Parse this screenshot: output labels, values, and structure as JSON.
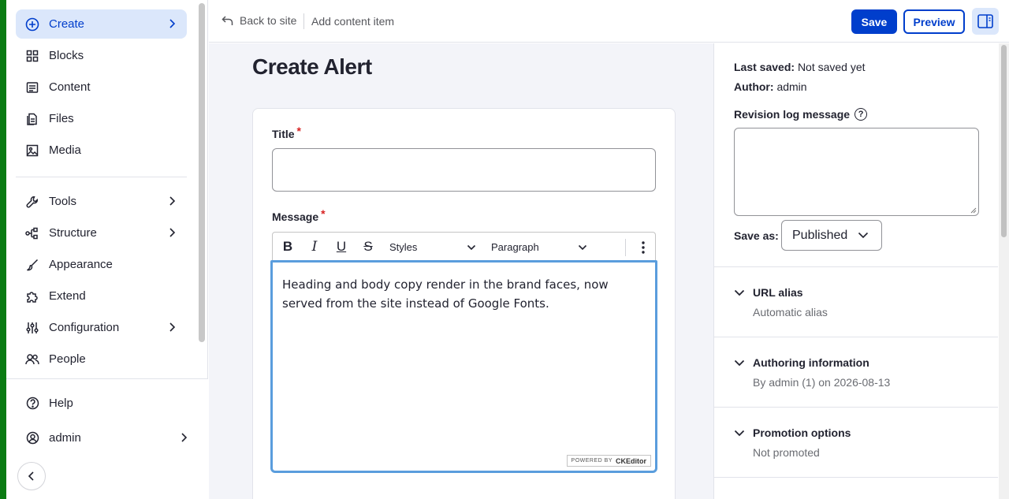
{
  "sidebar": {
    "items": [
      {
        "label": "Create",
        "icon": "plus-circle-icon",
        "active": true,
        "has_children": true
      },
      {
        "label": "Blocks",
        "icon": "blocks-icon"
      },
      {
        "label": "Content",
        "icon": "content-icon"
      },
      {
        "label": "Files",
        "icon": "files-icon"
      },
      {
        "label": "Media",
        "icon": "media-icon"
      },
      {
        "label": "Tools",
        "icon": "wrench-icon",
        "has_children": true
      },
      {
        "label": "Structure",
        "icon": "structure-icon",
        "has_children": true
      },
      {
        "label": "Appearance",
        "icon": "brush-icon"
      },
      {
        "label": "Extend",
        "icon": "puzzle-icon"
      },
      {
        "label": "Configuration",
        "icon": "sliders-icon",
        "has_children": true
      },
      {
        "label": "People",
        "icon": "people-icon"
      }
    ],
    "bottom": {
      "help_label": "Help",
      "user_label": "admin"
    }
  },
  "topbar": {
    "back_label": "Back to site",
    "breadcrumb": "Add content item",
    "save_label": "Save",
    "preview_label": "Preview"
  },
  "main": {
    "page_title": "Create Alert",
    "title_label": "Title",
    "title_value": "",
    "message_label": "Message",
    "required_marker": "*",
    "toolbar": {
      "bold": "B",
      "italic": "I",
      "underline": "U",
      "strike": "S",
      "styles_label": "Styles",
      "paragraph_label": "Paragraph"
    },
    "message_body": "Heading and body copy render in the brand faces, now served from the site instead of Google Fonts.",
    "powered_prefix": "POWERED BY",
    "powered_brand": "CKEditor"
  },
  "right_panel": {
    "last_saved_label": "Last saved:",
    "last_saved_value": "Not saved yet",
    "author_label": "Author:",
    "author_value": "admin",
    "revision_label": "Revision log message",
    "revision_help": "?",
    "save_as_label": "Save as:",
    "save_as_value": "Published",
    "sections": [
      {
        "title": "URL alias",
        "summary": "Automatic alias"
      },
      {
        "title": "Authoring information",
        "summary": "By admin (1) on 2026-08-13"
      },
      {
        "title": "Promotion options",
        "summary": "Not promoted"
      }
    ]
  },
  "colors": {
    "accent": "#003ecc",
    "active_bg": "#dbe7fb",
    "focus_ring": "#5a9ddd",
    "required": "#d72222",
    "edge": "#0a7b12"
  }
}
